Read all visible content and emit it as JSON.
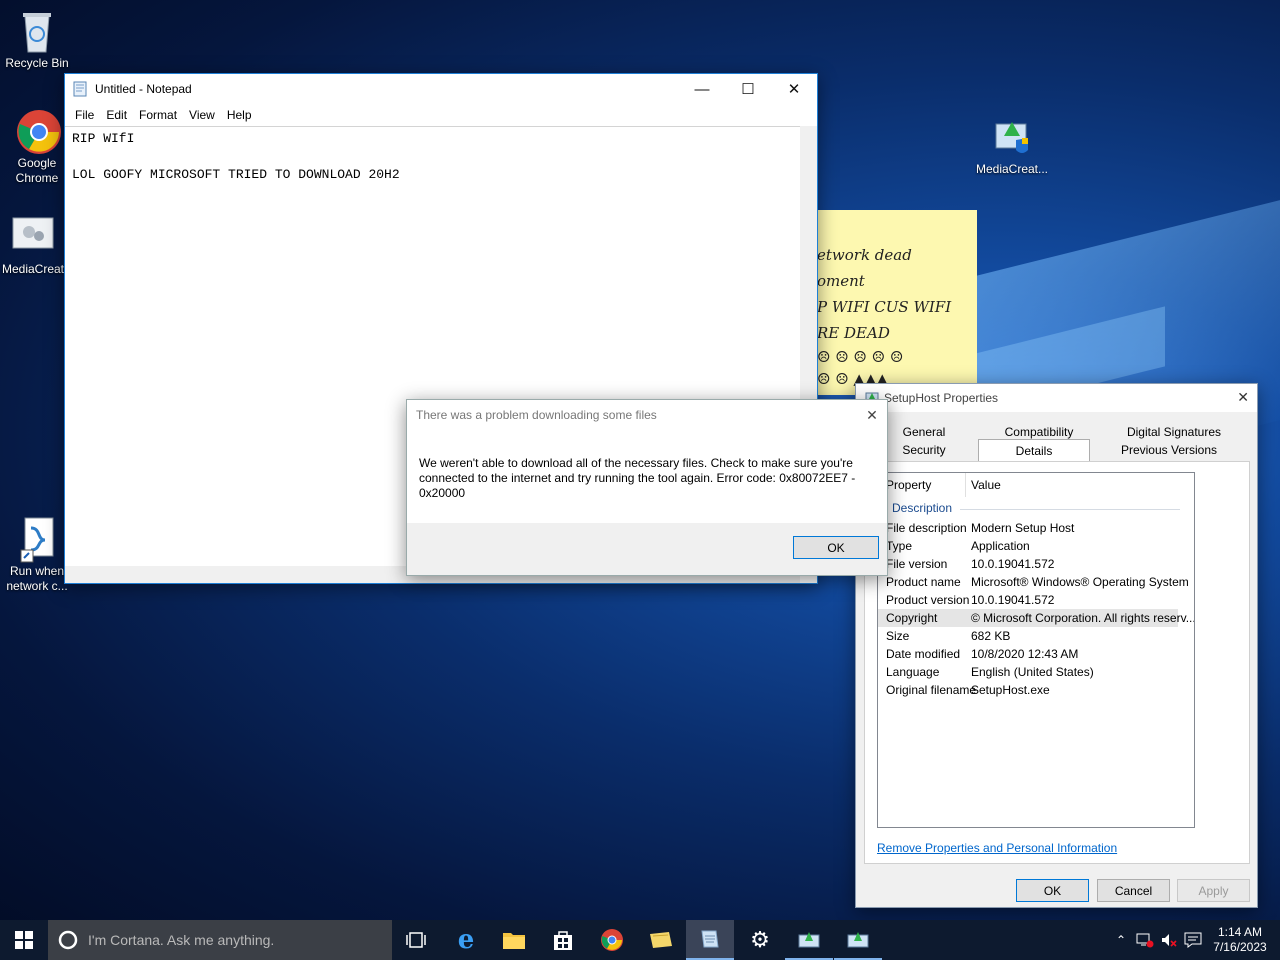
{
  "desktop": {
    "icons": [
      {
        "label": "Recycle Bin"
      },
      {
        "label": "Google Chrome"
      },
      {
        "label": "MediaCreat"
      },
      {
        "label": "Run when network c..."
      },
      {
        "label": "MediaCreat..."
      }
    ]
  },
  "notepad": {
    "title": "Untitled - Notepad",
    "menu": [
      "File",
      "Edit",
      "Format",
      "View",
      "Help"
    ],
    "lines": [
      "RIP WIfI",
      "",
      "LOL GOOFY MICROSOFT TRIED TO DOWNLOAD 20H2"
    ]
  },
  "sticky": {
    "lines": [
      "etwork dead",
      "oment",
      "P WIFI CUS WIFI",
      "RE DEAD"
    ]
  },
  "error_dialog": {
    "title": "There was a problem downloading some files",
    "message": "We weren't able to download all of the necessary files. Check to make sure you're connected to the internet and try running the tool again. Error code: 0x80072EE7 - 0x20000",
    "ok": "OK"
  },
  "properties": {
    "title": "SetupHost Properties",
    "tabs_row1": [
      "General",
      "Compatibility",
      "Digital Signatures"
    ],
    "tabs_row2": [
      "Security",
      "Details",
      "Previous Versions"
    ],
    "header_property": "Property",
    "header_value": "Value",
    "section": "Description",
    "rows": [
      {
        "k": "File description",
        "v": "Modern Setup Host"
      },
      {
        "k": "Type",
        "v": "Application"
      },
      {
        "k": "File version",
        "v": "10.0.19041.572"
      },
      {
        "k": "Product name",
        "v": "Microsoft® Windows® Operating System"
      },
      {
        "k": "Product version",
        "v": "10.0.19041.572"
      },
      {
        "k": "Copyright",
        "v": "© Microsoft Corporation. All rights reserv..."
      },
      {
        "k": "Size",
        "v": "682 KB"
      },
      {
        "k": "Date modified",
        "v": "10/8/2020 12:43 AM"
      },
      {
        "k": "Language",
        "v": "English (United States)"
      },
      {
        "k": "Original filename",
        "v": "SetupHost.exe"
      }
    ],
    "remove_link": "Remove Properties and Personal Information",
    "ok": "OK",
    "cancel": "Cancel",
    "apply": "Apply"
  },
  "taskbar": {
    "search_placeholder": "I'm Cortana. Ask me anything.",
    "time": "1:14 AM",
    "date": "7/16/2023"
  }
}
